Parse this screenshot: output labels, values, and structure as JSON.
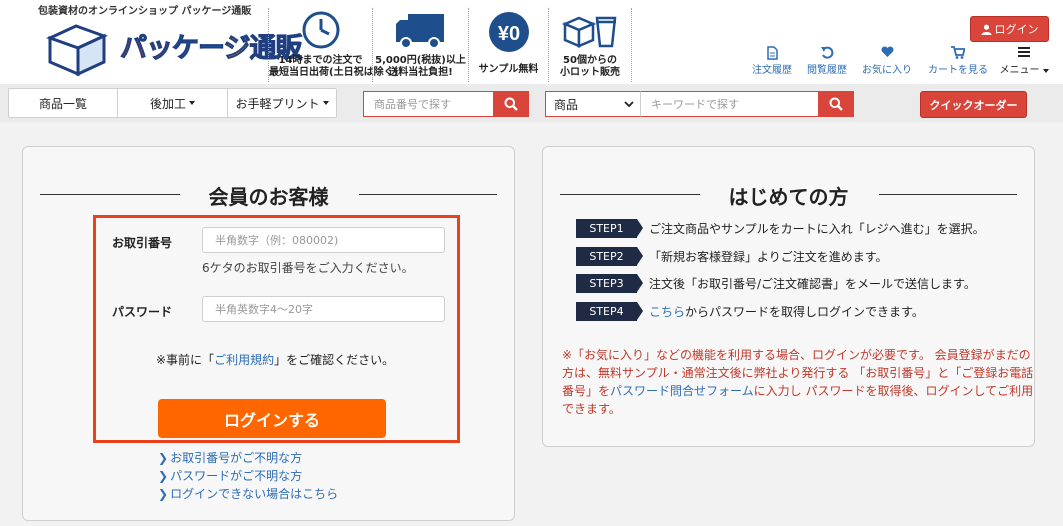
{
  "header": {
    "tagline": "包装資材のオンラインショップ パッケージ通販",
    "logo": {
      "p1": "パッ",
      "p2": "ケー",
      "p3": "ジ",
      "p4": "通販"
    },
    "features": [
      {
        "icon": "clock-icon",
        "line1": "14時までの注文で",
        "line2": "最短当日出荷(土日祝は除く)"
      },
      {
        "icon": "truck-icon",
        "line1": "5,000円(税抜)以上",
        "line2": "送料当社負担!"
      },
      {
        "icon": "yen-icon",
        "yen_text": "¥0",
        "line1": "サンプル無料",
        "line2": ""
      },
      {
        "icon": "box-cup-icon",
        "line1": "50個からの",
        "line2": "小ロット販売"
      }
    ],
    "login_label": "ログイン",
    "util_links": [
      {
        "icon": "document-icon",
        "label": "注文履歴"
      },
      {
        "icon": "history-icon",
        "label": "閲覧履歴"
      },
      {
        "icon": "heart-icon",
        "label": "お気に入り"
      },
      {
        "icon": "cart-icon",
        "label": "カートを見る"
      },
      {
        "icon": "menu-icon",
        "label": "メニュー"
      }
    ]
  },
  "nav": {
    "items": [
      {
        "label": "商品一覧",
        "dropdown": false
      },
      {
        "label": "後加工",
        "dropdown": true
      },
      {
        "label": "お手軽プリント",
        "dropdown": true
      }
    ],
    "product_search_placeholder": "商品番号で探す",
    "category_select": "商品",
    "keyword_placeholder": "キーワードで探す",
    "quick_order": "クイックオーダー"
  },
  "member": {
    "title": "会員のお客様",
    "account_label": "お取引番号",
    "account_placeholder": "半角数字（例：080002)",
    "account_hint": "6ケタのお取引番号をご入力ください。",
    "password_label": "パスワード",
    "password_placeholder": "半角英数字4～20字",
    "terms_pre": "※事前に「",
    "terms_link": "ご利用規約",
    "terms_post": "」をご確認ください。",
    "submit": "ログインする",
    "links": [
      "お取引番号がご不明な方",
      "パスワードがご不明な方",
      "ログインできない場合はこちら"
    ]
  },
  "newcomer": {
    "title": "はじめての方",
    "steps": [
      {
        "tag": "STEP1",
        "text": "ご注文商品やサンプルをカートに入れ「レジへ進む」を選択。"
      },
      {
        "tag": "STEP2",
        "text": "「新規お客様登録」よりご注文を進めます。"
      },
      {
        "tag": "STEP3",
        "text": "注文後「お取引番号/ご注文確認書」をメールで送信します。"
      },
      {
        "tag": "STEP4",
        "link": "こちら",
        "text": "からパスワードを取得しログインできます。"
      }
    ],
    "note_a": "※「お気に入り」などの機能を利用する場合、ログインが必要です。 会員登録がまだの方は、無料サンプル・通常注文後に弊社より発行する 「お取引番号」と「ご登録お電話番号」を",
    "note_link": "パスワード問合せフォーム",
    "note_b": "に入力し パスワードを取得後、ログインしてご利用できます。"
  }
}
